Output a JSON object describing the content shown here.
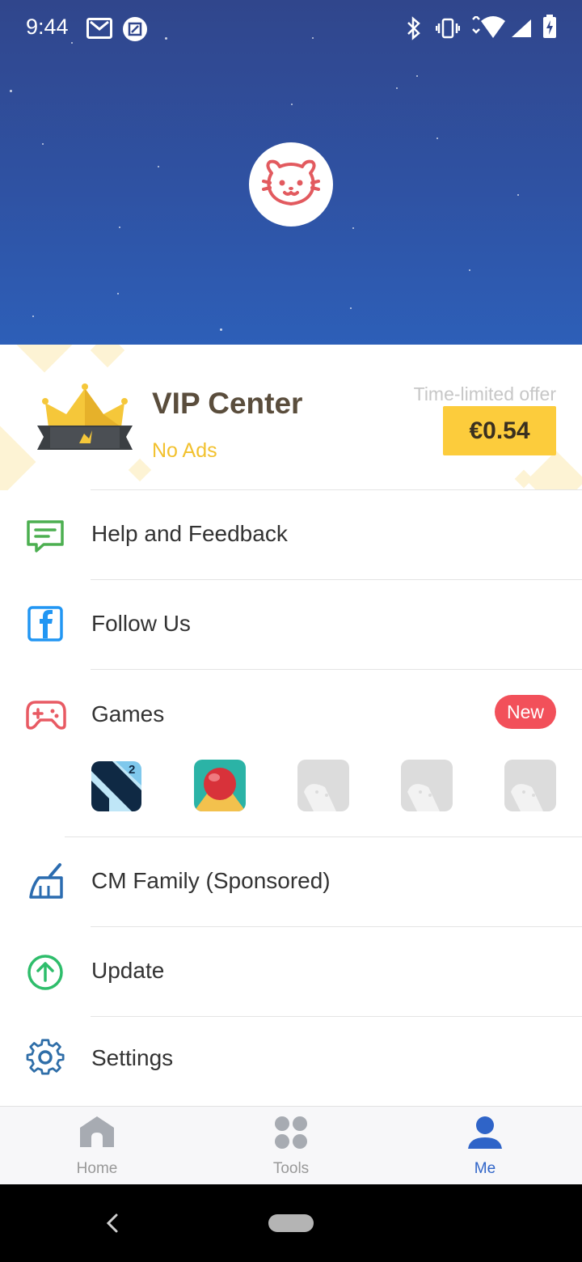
{
  "status_bar": {
    "time": "9:44"
  },
  "vip": {
    "title": "VIP Center",
    "subtitle": "No Ads",
    "offer_label": "Time-limited offer",
    "price": "€0.54"
  },
  "menu": {
    "help": "Help and Feedback",
    "follow": "Follow Us",
    "games": "Games",
    "games_badge": "New",
    "cm_family": "CM Family (Sponsored)",
    "update": "Update",
    "settings": "Settings"
  },
  "nav": {
    "home": "Home",
    "tools": "Tools",
    "me": "Me",
    "active": "me"
  },
  "colors": {
    "header_top": "#30468c",
    "header_bottom": "#2d5fb8",
    "vip_gold": "#fccc3c",
    "badge_red": "#f2505a",
    "nav_active": "#2f64c8",
    "help_green": "#4caf50",
    "facebook_blue": "#2196f3",
    "games_red": "#e85a63",
    "cm_blue": "#2b6cb0",
    "update_green": "#2ebd6b",
    "settings_blue": "#2f6ea8"
  },
  "icons": {
    "status": [
      "gmail-icon",
      "screenshot-icon",
      "bluetooth-icon",
      "vibrate-icon",
      "wifi-icon",
      "signal-icon",
      "battery-icon"
    ],
    "menu": [
      "feedback-icon",
      "facebook-icon",
      "gamepad-icon",
      "broom-icon",
      "arrow-up-icon",
      "gear-icon"
    ],
    "nav": [
      "home-icon",
      "tools-icon",
      "person-icon"
    ]
  }
}
